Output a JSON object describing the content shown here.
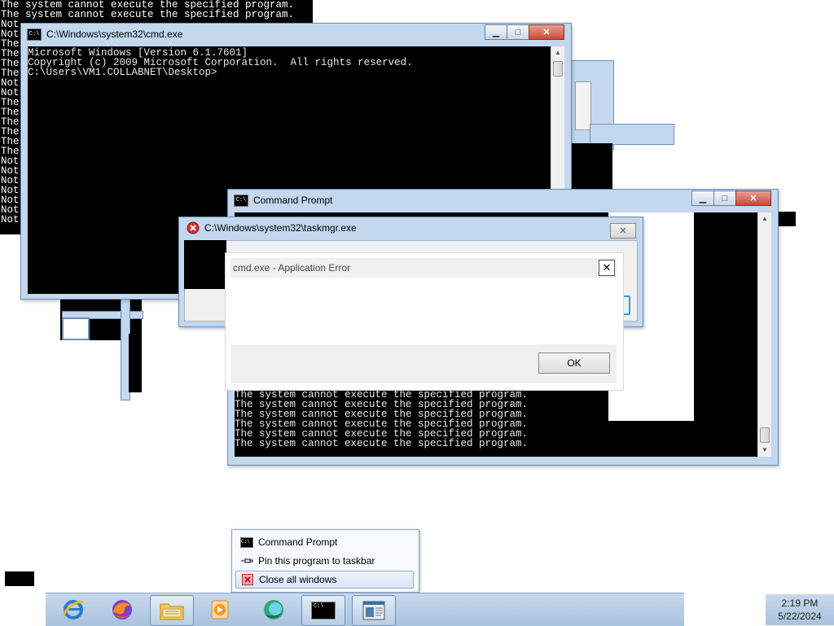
{
  "background_console": {
    "lines": [
      "The system cannot execute the specified program.",
      "The system cannot execute the specified program."
    ],
    "left_fragments": [
      "Not",
      "Not",
      "The",
      "The",
      "The",
      "The",
      "Not",
      "Not",
      "The",
      "The",
      "The",
      "The",
      "The",
      "The",
      "Not",
      "Not",
      "Not",
      "Not",
      "Not",
      "Not",
      "Not"
    ]
  },
  "cmd_window": {
    "title": "C:\\Windows\\system32\\cmd.exe",
    "lines": [
      "Microsoft Windows [Version 6.1.7601]",
      "Copyright (c) 2009 Microsoft Corporation.  All rights reserved.",
      "",
      "C:\\Users\\VM1.COLLABNET\\Desktop>"
    ],
    "icon_label": "C:\\"
  },
  "command_prompt_window": {
    "title": "Command Prompt",
    "lines": [
      "The system cannot execute the specified program.",
      "The system cannot execute the specified program.",
      "The system cannot execute the specified program.",
      "The system cannot execute the specified program.",
      "The system cannot execute the specified program.",
      "The system cannot execute the specified program."
    ],
    "icon_label": "C:\\"
  },
  "taskmgr_window": {
    "title": "C:\\Windows\\system32\\taskmgr.exe"
  },
  "error_dialog": {
    "title": "cmd.exe - Application Error",
    "message": "",
    "ok_label": "OK",
    "close_glyph": "✕"
  },
  "caption_glyphs": {
    "minimize": "▁",
    "maximize": "□",
    "close": "✕"
  },
  "jump_list": {
    "items": [
      {
        "label": "Command Prompt",
        "icon": "console-icon",
        "highlighted": false
      },
      {
        "label": "Pin this program to taskbar",
        "icon": "pin-icon",
        "highlighted": false
      },
      {
        "label": "Close all windows",
        "icon": "close-windows-icon",
        "highlighted": true
      }
    ]
  },
  "taskbar": {
    "items": [
      {
        "name": "internet-explorer",
        "icon": "ie-icon",
        "running": false
      },
      {
        "name": "firefox",
        "icon": "firefox-icon",
        "running": false
      },
      {
        "name": "file-explorer",
        "icon": "folder-icon",
        "running": true
      },
      {
        "name": "media-player",
        "icon": "media-player-icon",
        "running": false
      },
      {
        "name": "app-green",
        "icon": "green-app-icon",
        "running": false
      },
      {
        "name": "command-prompt",
        "icon": "console-icon",
        "running": true
      },
      {
        "name": "app-window",
        "icon": "window-app-icon",
        "running": true
      }
    ]
  },
  "clock": {
    "time": "2:19 PM",
    "date": "5/22/2024"
  },
  "colors": {
    "frame": "#c3d7ee",
    "close_red": "#c94a35",
    "console_bg": "#000000",
    "console_fg": "#e8e8e8",
    "error_red": "#d32f2f"
  }
}
